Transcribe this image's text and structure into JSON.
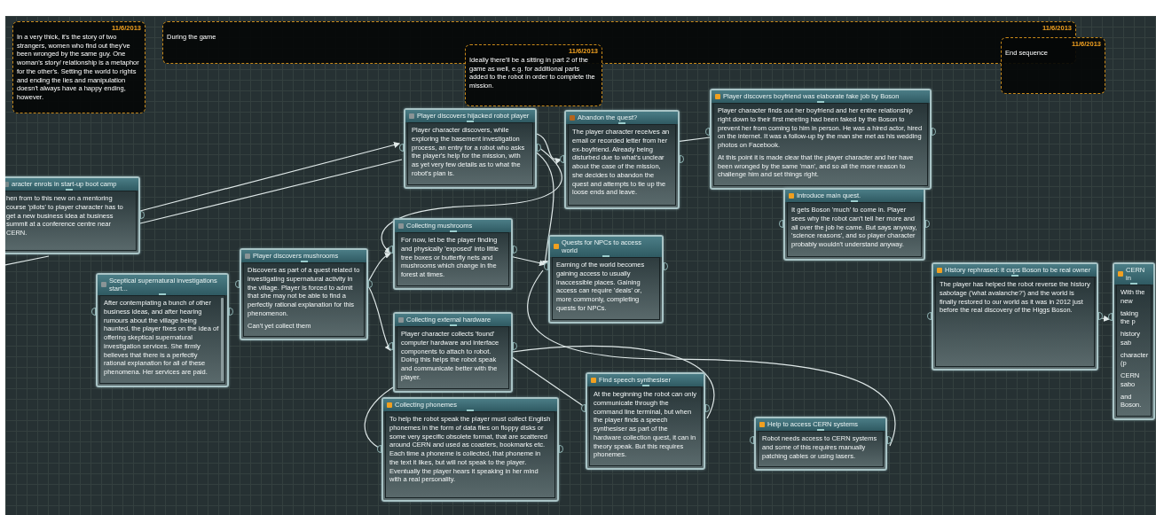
{
  "comments": [
    {
      "date": "11/6/2013",
      "text": "In a very thick, it's the story of two strangers, women who find out they've been wronged by the same guy. One woman's story/ relationship is a metaphor for the other's. Setting the world to rights and ending the lies and manipulation doesn't always have a happy ending, however."
    },
    {
      "date": "11/6/2013",
      "text": "During the game"
    },
    {
      "date": "11/6/2013",
      "text": "Ideally there'll be a sitting in part 2 of the game as well, e.g. for additional parts added to the robot in order to complete the mission."
    },
    {
      "date": "11/6/2013",
      "text": "End sequence"
    }
  ],
  "nodes": [
    {
      "title": "aracter enrols in start-up boot camp",
      "color": "#7a8a8c",
      "paragraphs": [
        "hen from to this new on a mentoring course 'pilots' to player character has to get a new business idea at business summit at a conference centre near CERN."
      ]
    },
    {
      "title": "Player discovers hijacked robot player",
      "color": "#8a9496",
      "paragraphs": [
        "Player character discovers, while exploring the basement investigation process, an entry for a robot who asks the player's help for the mission, with as yet very few details as to what the robot's plan is."
      ]
    },
    {
      "title": "Abandon the quest?",
      "color": "#b5651d",
      "paragraphs": [
        "The player character receives an email or recorded letter from her ex-boyfriend. Already being disturbed due to what's unclear about the case of the mission, she decides to abandon the quest and attempts to tie up the loose ends and leave."
      ]
    },
    {
      "title": "Player discovers boyfriend was elaborate fake job by Boson",
      "color": "#f0a020",
      "paragraphs": [
        "Player character finds out her boyfriend and her entire relationship right down to their first meeting had been faked by the Boson to prevent her from coming to him in person. He was a hired actor, hired on the internet. It was a follow-up by the man she met as his wedding photos on Facebook.",
        "At this point it is made clear that the player character and her have been wronged by the same 'man', and so all the more reason to challenge him and set things right."
      ]
    },
    {
      "title": "Introduce main quest.",
      "color": "#f0a020",
      "paragraphs": [
        "It gets Boson 'much' to come in. Player sees why the robot can't tell her more and all over the job he came. But says anyway, 'science reasons', and so player character probably wouldn't understand anyway."
      ]
    },
    {
      "title": "Player discovers mushrooms",
      "color": "#8a9496",
      "paragraphs": [
        "Discovers as part of a quest related to investigating supernatural activity in the village. Player is forced to admit that she may not be able to find a perfectly rational explanation for this phenomenon.",
        "Can't yet collect them"
      ]
    },
    {
      "title": "Sceptical supernatural investigations start...",
      "color": "#8a9496",
      "paragraphs": [
        "After contemplating a bunch of other business ideas, and after hearing rumours about the village being haunted, the player fixes on the idea of offering skeptical supernatural investigation services. She firmly believes that there is a perfectly rational explanation for all of these phenomena. Her services are paid."
      ]
    },
    {
      "title": "Collecting mushrooms",
      "color": "#8a9496",
      "paragraphs": [
        "For now, let be the player finding and physically 'exposed' into little tree boxes or butterfly nets and mushrooms which change in the forest at times."
      ]
    },
    {
      "title": "Quests for NPCs to access world",
      "color": "#f0a020",
      "paragraphs": [
        "Earning of the world becomes gaining access to usually inaccessible places. Gaining access can require 'deals' or, more commonly, completing quests for NPCs."
      ]
    },
    {
      "title": "Collecting external hardware",
      "color": "#8a9496",
      "paragraphs": [
        "Player character collects 'found' computer hardware and interface components to attach to robot. Doing this helps the robot speak and communicate better with the player."
      ]
    },
    {
      "title": "Collecting phonemes",
      "color": "#f0a020",
      "paragraphs": [
        "To help the robot speak the player must collect English phonemes in the form of data files on floppy disks or some very specific obsolete format, that are scattered around CERN and used as coasters, bookmarks etc. Each time a phoneme is collected, that phoneme in the text it likes, but will not speak to the player. Eventually the player hears it speaking in her mind with a real personality."
      ]
    },
    {
      "title": "Find speech synthesiser",
      "color": "#f0a020",
      "paragraphs": [
        "At the beginning the robot can only communicate through the command line terminal, but when the player finds a speech synthesiser as part of the hardware collection quest, it can in theory speak. But this requires phonemes."
      ]
    },
    {
      "title": "Help to access CERN systems",
      "color": "#f0a020",
      "paragraphs": [
        "Robot needs access to CERN systems and some of this requires manually patching cables or using lasers."
      ]
    },
    {
      "title": "History rephrased: it cups Boson to be real owner",
      "color": "#f0a020",
      "paragraphs": [
        "The player has helped the robot reverse the history sabotage ('what avalanche?') and the world is finally restored to our world as it was in 2012 just before the real discovery of the Higgs Boson."
      ]
    },
    {
      "title": "CERN in",
      "color": "#f0a020",
      "paragraphs": [
        "With the new",
        "taking the p",
        "history sab",
        "character (p",
        "CERN sabo",
        "and Boson."
      ]
    }
  ]
}
